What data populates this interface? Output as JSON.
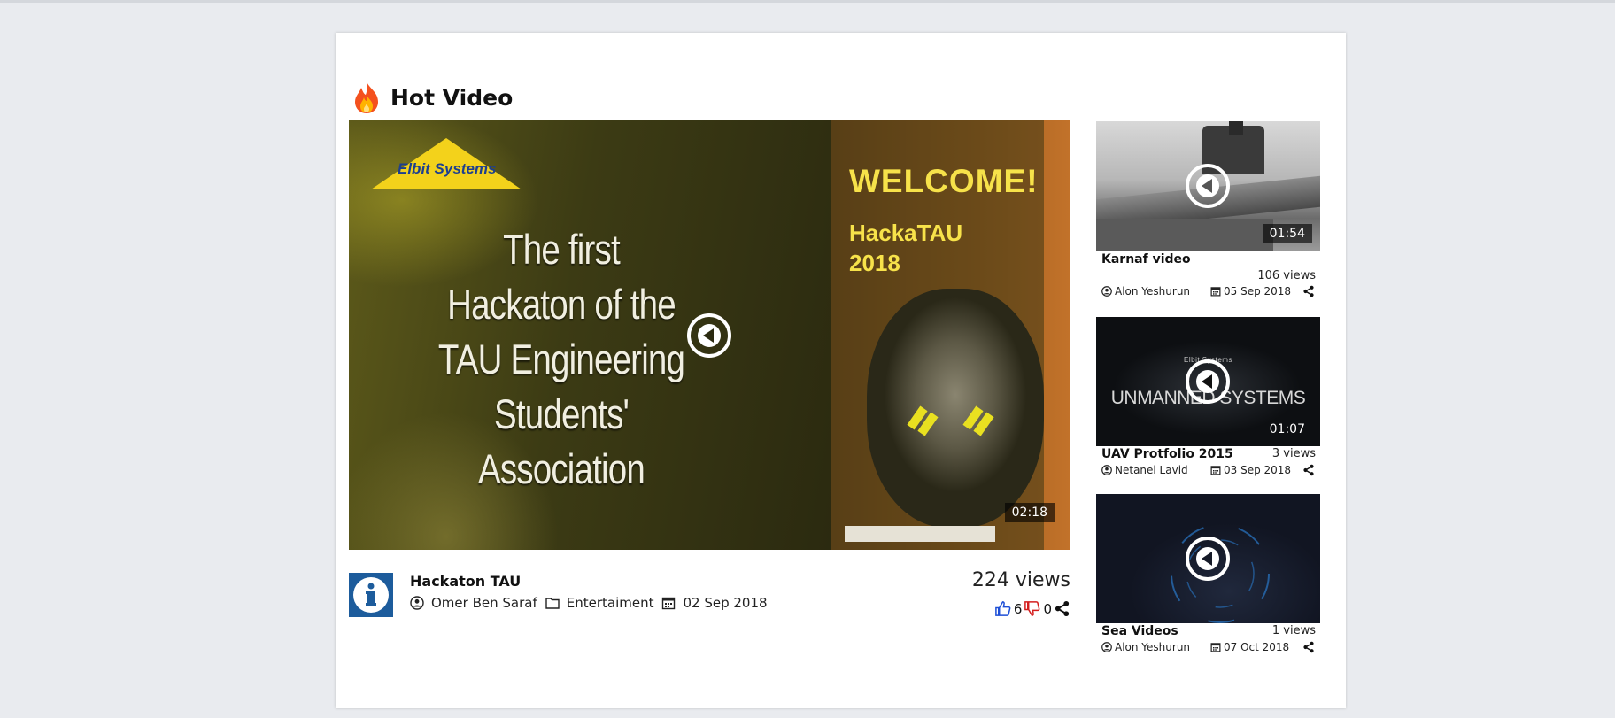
{
  "section": {
    "title": "Hot Video",
    "icon": "flame-icon"
  },
  "main_video": {
    "thumbnail_text": {
      "brand": "Elbit Systems",
      "headline": "The first Hackaton of the TAU Engineering Students' Association",
      "welcome": "WELCOME!",
      "event": "HackaTAU 2018"
    },
    "duration": "02:18",
    "title": "Hackaton TAU",
    "author": "Omer Ben Saraf",
    "category": "Entertaiment",
    "date": "02 Sep 2018",
    "views": "224 views",
    "likes": "6",
    "dislikes": "0"
  },
  "side_videos": [
    {
      "title": "Karnaf video",
      "views": "106 views",
      "author": "Alon Yeshurun",
      "date": "05 Sep 2018",
      "duration": "01:54"
    },
    {
      "title": "UAV Protfolio 2015",
      "views": "3 views",
      "author": "Netanel Lavid",
      "date": "03 Sep 2018",
      "duration": "01:07",
      "thumbnail_text": "UNMANNED SYSTEMS",
      "brand": "Elbit Systems"
    },
    {
      "title": "Sea Videos",
      "views": "1 views",
      "author": "Alon Yeshurun",
      "date": "07 Oct 2018"
    }
  ],
  "colors": {
    "like": "#1e4fd6",
    "dislike": "#d41f1f",
    "info_icon_bg": "#1d5c9c",
    "page_bg": "#e9ebef"
  }
}
